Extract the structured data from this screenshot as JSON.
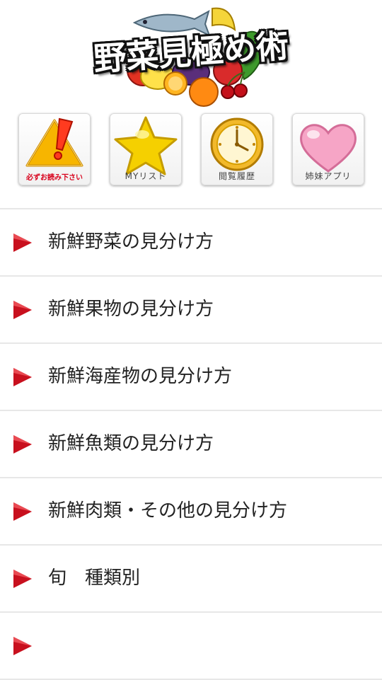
{
  "header": {
    "logo_title": "野菜見極め術",
    "logo_icon": "vegetables-fruits-fish-illustration"
  },
  "icon_buttons": [
    {
      "label": "必ずお読み下さい",
      "icon": "warning-icon"
    },
    {
      "label": "MYリスト",
      "icon": "star-icon"
    },
    {
      "label": "閲覧履歴",
      "icon": "clock-icon"
    },
    {
      "label": "姉妹アプリ",
      "icon": "heart-icon"
    }
  ],
  "menu": {
    "items": [
      {
        "label": "新鮮野菜の見分け方"
      },
      {
        "label": "新鮮果物の見分け方"
      },
      {
        "label": "新鮮海産物の見分け方"
      },
      {
        "label": "新鮮魚類の見分け方"
      },
      {
        "label": "新鮮肉類・その他の見分け方"
      },
      {
        "label": "旬　種類別"
      }
    ]
  },
  "colors": {
    "arrow": "#c8101e",
    "divider": "#e7e7e7",
    "text": "#222222",
    "warning": "#f7b500",
    "star": "#f5d000",
    "heart": "#f6a5c6"
  }
}
